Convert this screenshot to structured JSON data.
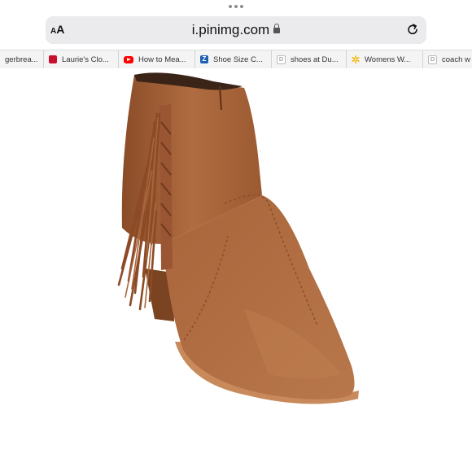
{
  "browser": {
    "reader_button": "AA",
    "url": "i.pinimg.com",
    "icons": [
      "tabs-dots-icon",
      "lock-icon",
      "reload-icon"
    ]
  },
  "bookmarks": [
    {
      "label": "gerbrea...",
      "icon": "none"
    },
    {
      "label": "Laurie's Clo...",
      "icon": "red-logo-icon"
    },
    {
      "label": "How to Mea...",
      "icon": "youtube-icon"
    },
    {
      "label": "Shoe Size C...",
      "icon": "z-logo-icon"
    },
    {
      "label": "shoes at Du...",
      "icon": "d-letter-icon"
    },
    {
      "label": "Womens W...",
      "icon": "walmart-spark-icon"
    },
    {
      "label": "coach w",
      "icon": "d-letter-icon"
    }
  ],
  "image": {
    "subject": "tan suede fringe ankle boot",
    "colors": {
      "suede": "#a8663c",
      "suede_shadow": "#7a4322",
      "sole": "#c88a5a",
      "lining": "#3a2418"
    }
  }
}
